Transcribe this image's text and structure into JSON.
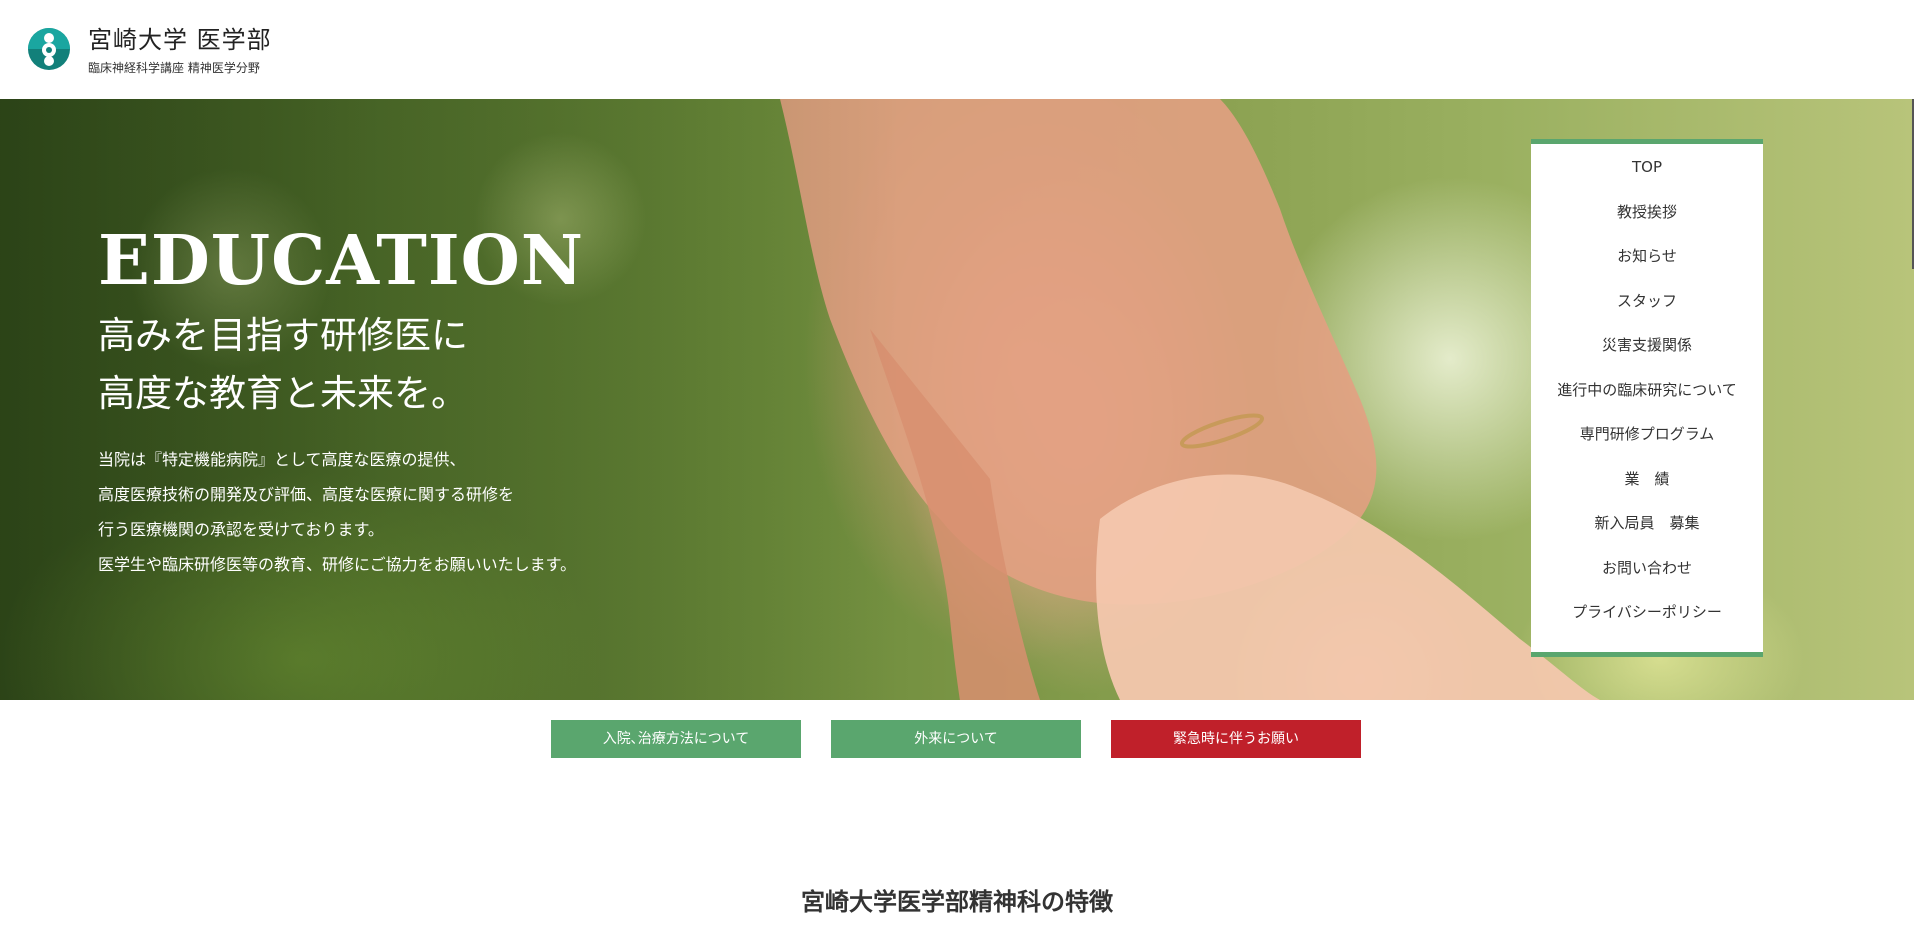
{
  "header": {
    "title": "宮崎大学 医学部",
    "subtitle": "臨床神経科学講座 精神医学分野",
    "logo_icon": "university-emblem-icon"
  },
  "hero": {
    "heading": "EDUCATION",
    "lead": [
      "高みを目指す研修医に",
      "高度な教育と未来を。"
    ],
    "body": [
      "当院は『特定機能病院』として高度な医療の提供、",
      "高度医療技術の開発及び評価、高度な医療に関する研修を",
      "行う医療機関の承認を受けております。",
      "医学生や臨床研修医等の教育、研修にご協力をお願いいたします。"
    ]
  },
  "nav": {
    "items": [
      {
        "label": "TOP"
      },
      {
        "label": "教授挨拶"
      },
      {
        "label": "お知らせ"
      },
      {
        "label": "スタッフ"
      },
      {
        "label": "災害支援関係"
      },
      {
        "label": "進行中の臨床研究について"
      },
      {
        "label": "専門研修プログラム"
      },
      {
        "label": "業　績"
      },
      {
        "label": "新入局員　募集"
      },
      {
        "label": "お問い合わせ"
      },
      {
        "label": "プライバシーポリシー"
      }
    ]
  },
  "buttons": {
    "admission": "入院､治療方法について",
    "outpatient": "外来について",
    "emergency": "緊急時に伴うお願い"
  },
  "section": {
    "title": "宮崎大学医学部精神科の特徴"
  },
  "colors": {
    "accent_green": "#5aa66e",
    "emergency_red": "#c0202a",
    "logo_teal": "#12807a"
  }
}
